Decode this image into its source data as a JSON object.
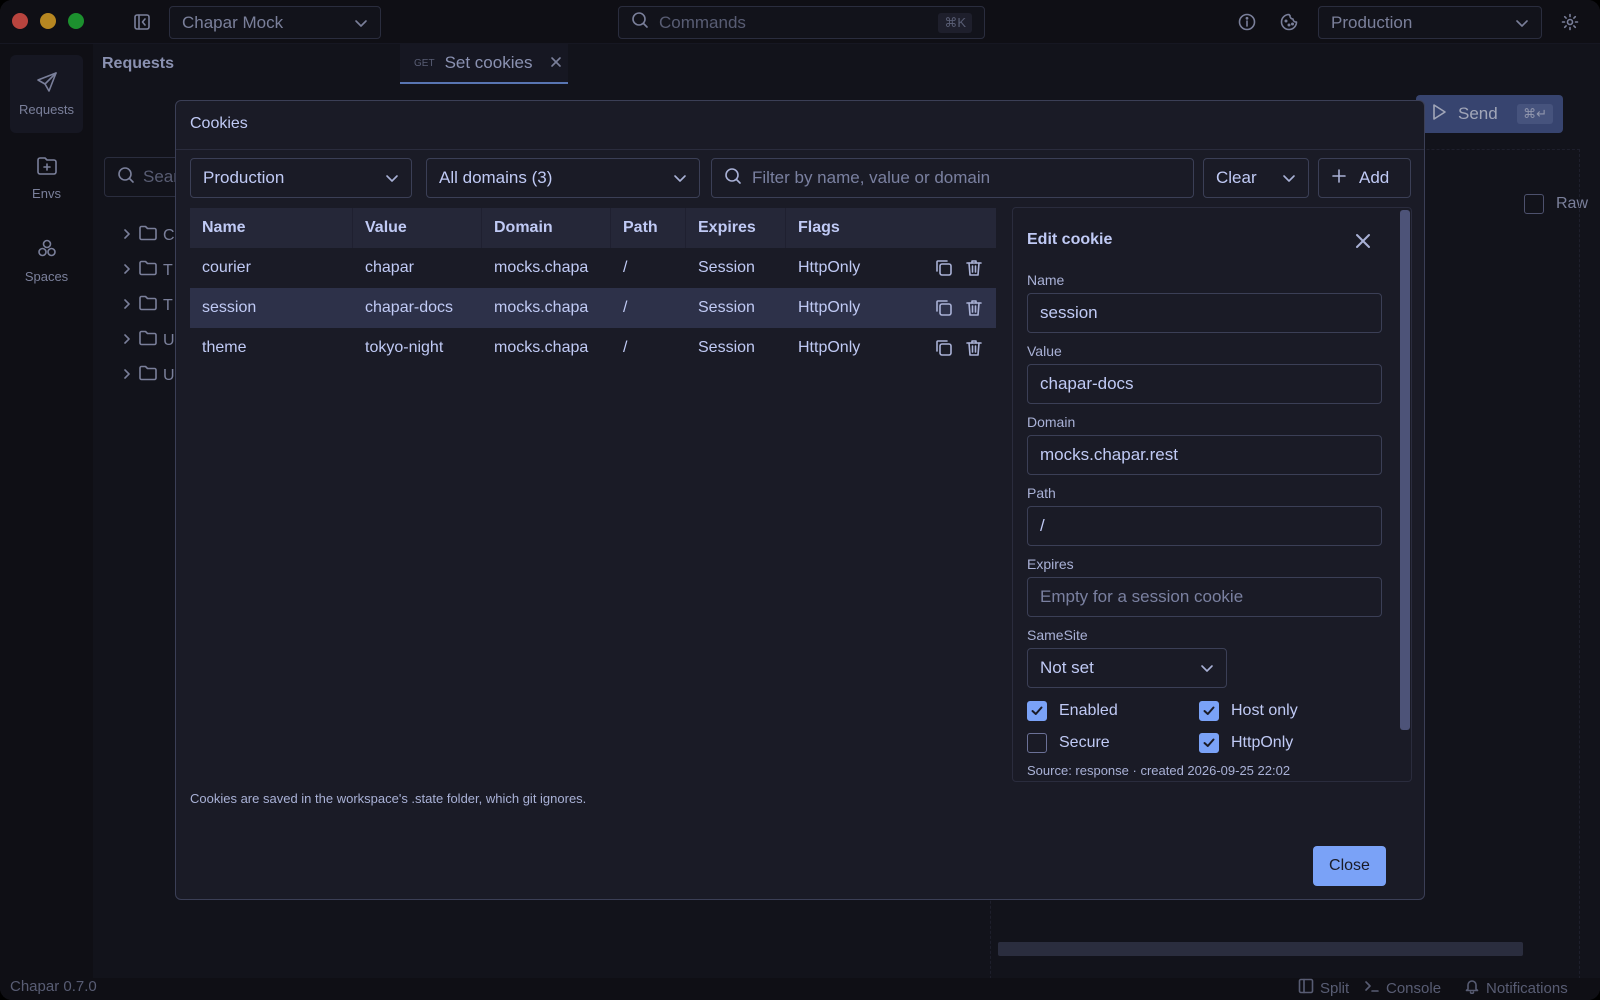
{
  "titlebar": {
    "workspace": "Chapar Mock",
    "commands_label": "Commands",
    "commands_shortcut": "⌘K",
    "environment": "Production"
  },
  "rail": {
    "items": [
      {
        "label": "Requests",
        "icon": "paper-plane-icon"
      },
      {
        "label": "Envs",
        "icon": "folder-plus-icon"
      },
      {
        "label": "Spaces",
        "icon": "spaces-icon"
      }
    ]
  },
  "sidebar": {
    "title": "Requests",
    "search_placeholder": "Sear",
    "tree": [
      {
        "label": "C"
      },
      {
        "label": "T"
      },
      {
        "label": "T"
      },
      {
        "label": "U"
      },
      {
        "label": "U"
      }
    ]
  },
  "tabs": [
    {
      "method": "GET",
      "title": "Set cookies"
    }
  ],
  "request_bar": {
    "send_label": "Send",
    "send_shortcut": "⌘↵",
    "raw_label": "Raw"
  },
  "statusbar": {
    "version": "Chapar 0.7.0",
    "split": "Split",
    "console": "Console",
    "notifications": "Notifications"
  },
  "modal": {
    "title": "Cookies",
    "environment": "Production",
    "domains": "All domains (3)",
    "filter_placeholder": "Filter by name, value or domain",
    "clear_label": "Clear",
    "add_label": "Add",
    "columns": [
      "Name",
      "Value",
      "Domain",
      "Path",
      "Expires",
      "Flags"
    ],
    "rows": [
      {
        "name": "courier",
        "value": "chapar",
        "domain": "mocks.chapa",
        "path": "/",
        "expires": "Session",
        "flags": "HttpOnly"
      },
      {
        "name": "session",
        "value": "chapar-docs",
        "domain": "mocks.chapa",
        "path": "/",
        "expires": "Session",
        "flags": "HttpOnly"
      },
      {
        "name": "theme",
        "value": "tokyo-night",
        "domain": "mocks.chapa",
        "path": "/",
        "expires": "Session",
        "flags": "HttpOnly"
      }
    ],
    "footnote": "Cookies are saved in the workspace's .state folder, which git ignores.",
    "close_label": "Close",
    "edit": {
      "title": "Edit cookie",
      "name_label": "Name",
      "name_value": "session",
      "value_label": "Value",
      "value_value": "chapar-docs",
      "domain_label": "Domain",
      "domain_value": "mocks.chapar.rest",
      "path_label": "Path",
      "path_value": "/",
      "expires_label": "Expires",
      "expires_placeholder": "Empty for a session cookie",
      "samesite_label": "SameSite",
      "samesite_value": "Not set",
      "enabled_label": "Enabled",
      "enabled": true,
      "hostonly_label": "Host only",
      "hostonly": true,
      "secure_label": "Secure",
      "secure": false,
      "httponly_label": "HttpOnly",
      "httponly": true,
      "source_line": "Source: response · created 2026-09-25 22:02"
    }
  },
  "colors": {
    "accent": "#7aa2f7",
    "background": "#1a1b26",
    "border": "#3b3f56"
  }
}
